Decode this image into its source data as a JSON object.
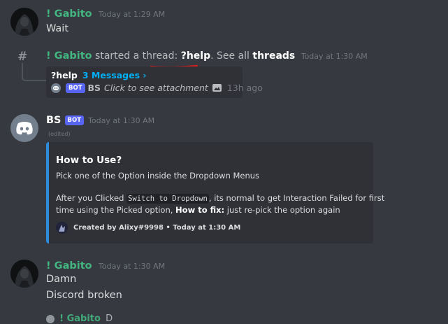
{
  "colors": {
    "background": "#36393f",
    "green_user": "#43b581",
    "embed_border": "#2f8bd8",
    "bot_blue": "#5865f2",
    "link_blue": "#00aff4",
    "annotation_red": "#e01e1e"
  },
  "messages": [
    {
      "author": "! Gabito",
      "timestamp": "Today at 1:29 AM",
      "lines": [
        "Wait"
      ]
    },
    {
      "thread_notice": {
        "author": "! Gabito",
        "action": "started a thread:",
        "thread_name": "?help",
        "see_all": ". See all",
        "threads_link": "threads",
        "timestamp": "Today at 1:30 AM"
      },
      "thread_card": {
        "name": "?help",
        "count": "3 Messages ›",
        "preview_bot_tag": "BOT",
        "preview_author": "BS",
        "preview_text": "Click to see attachment",
        "preview_time": "13h ago"
      }
    },
    {
      "author": "BS",
      "bot_tag": "BOT",
      "timestamp": "Today at 1:30 AM",
      "edited": "(edited)",
      "embed": {
        "title": "How to Use?",
        "line1": "Pick one of the Option inside the Dropdown Menus",
        "p2_before": "After you Clicked ",
        "p2_code": "Switch to Dropdown",
        "p2_after": ", its normal to get Interaction Failed for first",
        "p3_before": "time using the Picked option, ",
        "p3_bold": "How to fix:",
        "p3_after": " just re-pick the option again",
        "footer": "Created by Alixy#9998 • Today at 1:30 AM"
      }
    },
    {
      "author": "! Gabito",
      "timestamp": "Today at 1:30 AM",
      "lines": [
        "Damn",
        "Discord broken"
      ]
    }
  ],
  "cutoff_reply": {
    "author": "! Gabito",
    "text": "D"
  }
}
